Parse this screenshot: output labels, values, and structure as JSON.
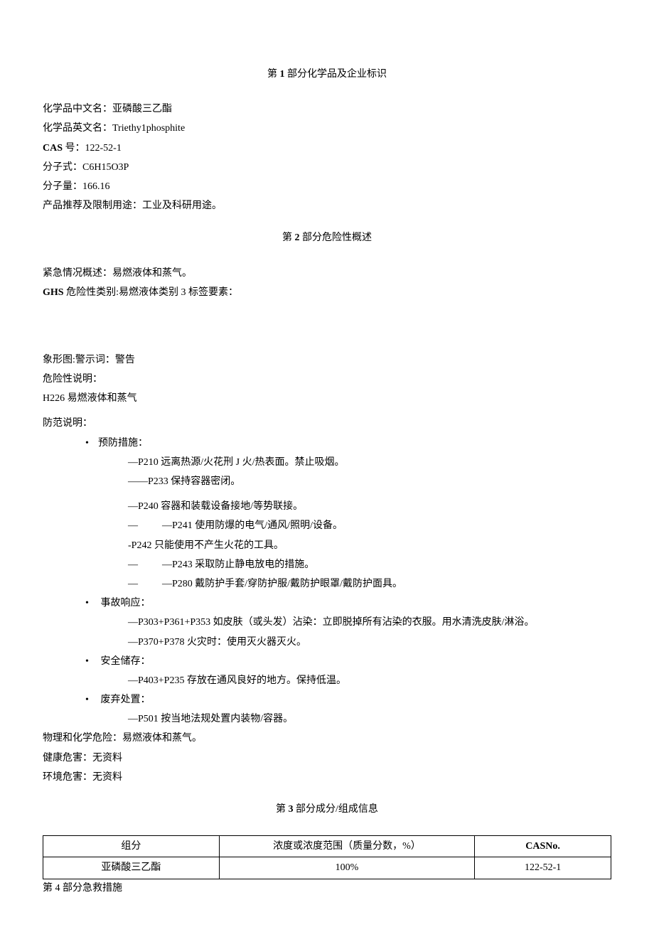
{
  "section1": {
    "title_prefix": "第",
    "title_num": "1",
    "title_suffix": "部分化学品及企业标识",
    "name_cn_label": "化学品中文名：",
    "name_cn_value": "亚磷酸三乙酯",
    "name_en_label": "化学品英文名：",
    "name_en_value": "Triethy1phosphite",
    "cas_label": "CAS",
    "cas_label2": "号：",
    "cas_value": "122-52-1",
    "formula_label": "分子式：",
    "formula_value": "C6H15O3P",
    "mw_label": "分子量：",
    "mw_value": "166.16",
    "use_label": "产品推荐及限制用途：",
    "use_value": "工业及科研用途。"
  },
  "section2": {
    "title_prefix": "第",
    "title_num": "2",
    "title_suffix": "部分危险性概述",
    "emergency_label": "紧急情况概述：",
    "emergency_value": "易燃液体和蒸气。",
    "ghs_label": "GHS",
    "ghs_label2": "危险性类别:",
    "ghs_value": "易燃液体类别 3 标签要素：",
    "pictogram_label": "象形图:",
    "signal_label": "警示词：",
    "signal_value": "警告",
    "hazard_stmt_label": "危险性说明：",
    "h226": "H226 易燃液体和蒸气",
    "precaution_label": "防范说明：",
    "prevent_label": "预防措施：",
    "p210": "—P210 远离热源/火花刑 J 火/热表面。禁止吸烟。",
    "p233": "——P233 保持容器密闭。",
    "p240": "—P240 容器和装载设备接地/等势联接。",
    "p241_pre": "—",
    "p241": "—P241 使用防爆的电气/通风/照明/设备。",
    "p242": "-P242 只能使用不产生火花的工具。",
    "p243_pre": "—",
    "p243": "—P243 采取防止静电放电的措施。",
    "p280_pre": "—",
    "p280": "—P280 戴防护手套/穿防护服/戴防护眼罩/戴防护面具。",
    "response_label": "事故响应：",
    "p303": "—P303+P361+P353 如皮肤（或头发）沾染：立即脱掉所有沾染的衣服。用水清洗皮肤/淋浴。",
    "p370": "—P370+P378 火灾时：使用灭火器灭火。",
    "storage_label": "安全储存：",
    "p403": "—P403+P235 存放在通风良好的地方。保持低温。",
    "disposal_label": "废弃处置：",
    "p501": "—P501 按当地法规处置内装物/容器。",
    "phys_label": "物理和化学危险：",
    "phys_value": "易燃液体和蒸气。",
    "health_label": "健康危害：",
    "health_value": "无资料",
    "env_label": "环境危害：",
    "env_value": "无资料"
  },
  "section3": {
    "title_prefix": "第",
    "title_num": "3",
    "title_suffix": "部分成分/组成信息",
    "col1": "组分",
    "col2": "浓度或浓度范围（质量分数，%）",
    "col3": "CASNo.",
    "row1_c1": "亚磷酸三乙酯",
    "row1_c2": "100%",
    "row1_c3": "122-52-1"
  },
  "section4": {
    "title": "第 4 部分急救措施"
  }
}
